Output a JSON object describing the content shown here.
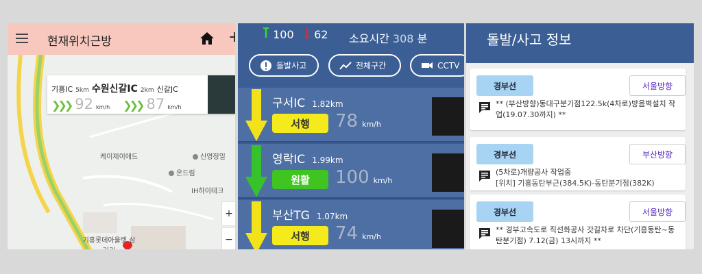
{
  "map_screen": {
    "title": "현재위치근방",
    "card": {
      "from": "기흥IC",
      "dist1": "5km",
      "current": "수원신갈IC",
      "dist2": "2km",
      "to": "신갈JC",
      "speed_left": "92",
      "speed_right": "87",
      "unit": "km/h"
    },
    "labels": {
      "kj": "케이제이애드",
      "shin": "신영정밀",
      "ondream": "온드림",
      "ih": "IH하이테크",
      "lotte": "기흥롯데아울렛 삼거리",
      "coach": "코치"
    }
  },
  "route_screen": {
    "up_count": "100",
    "down_count": "62",
    "duration_label": "소요시간",
    "duration_value": "308",
    "duration_unit": "분",
    "buttons": [
      "돌발사고",
      "전체구간",
      "CCTV"
    ],
    "segments": [
      {
        "name": "구서IC",
        "dist": "1.82km",
        "status": "서행",
        "status_color": "#f5ea1c",
        "speed": "78",
        "unit": "km/h",
        "arrow_color": "#f2e21a"
      },
      {
        "name": "영락IC",
        "dist": "1.99km",
        "status": "원활",
        "status_color": "#3fc421",
        "speed": "100",
        "unit": "km/h",
        "arrow_color": "#36c22a"
      },
      {
        "name": "부산TG",
        "dist": "1.07km",
        "status": "서행",
        "status_color": "#f5ea1c",
        "speed": "74",
        "unit": "km/h",
        "arrow_color": "#f2e21a"
      }
    ]
  },
  "incident_screen": {
    "title": "돌발/사고 정보",
    "items": [
      {
        "road": "경부선",
        "direction": "서울방향",
        "line1": "** (부산방향)동대구분기점122.5k(4차로)방음벽설치 작업(19.07.30까지) **",
        "line2": ""
      },
      {
        "road": "경부선",
        "direction": "부산방향",
        "line1": "(5차로)개량공사 작업중",
        "line2": "[위치] 기흥동탄부근(384.5K)-동탄분기점(382K)"
      },
      {
        "road": "경부선",
        "direction": "서울방향",
        "line1": "** 경부고속도로 직선화공사 갓길차로 차단(기흥동탄~동탄분기점) 7.12(금) 13시까지 **",
        "line2": ""
      }
    ]
  },
  "colors": {
    "blue": "#3b5f95",
    "badge_blue": "#a6d4f2",
    "direction_purple": "#5b2dbf",
    "header_pink": "#f8c8be"
  }
}
